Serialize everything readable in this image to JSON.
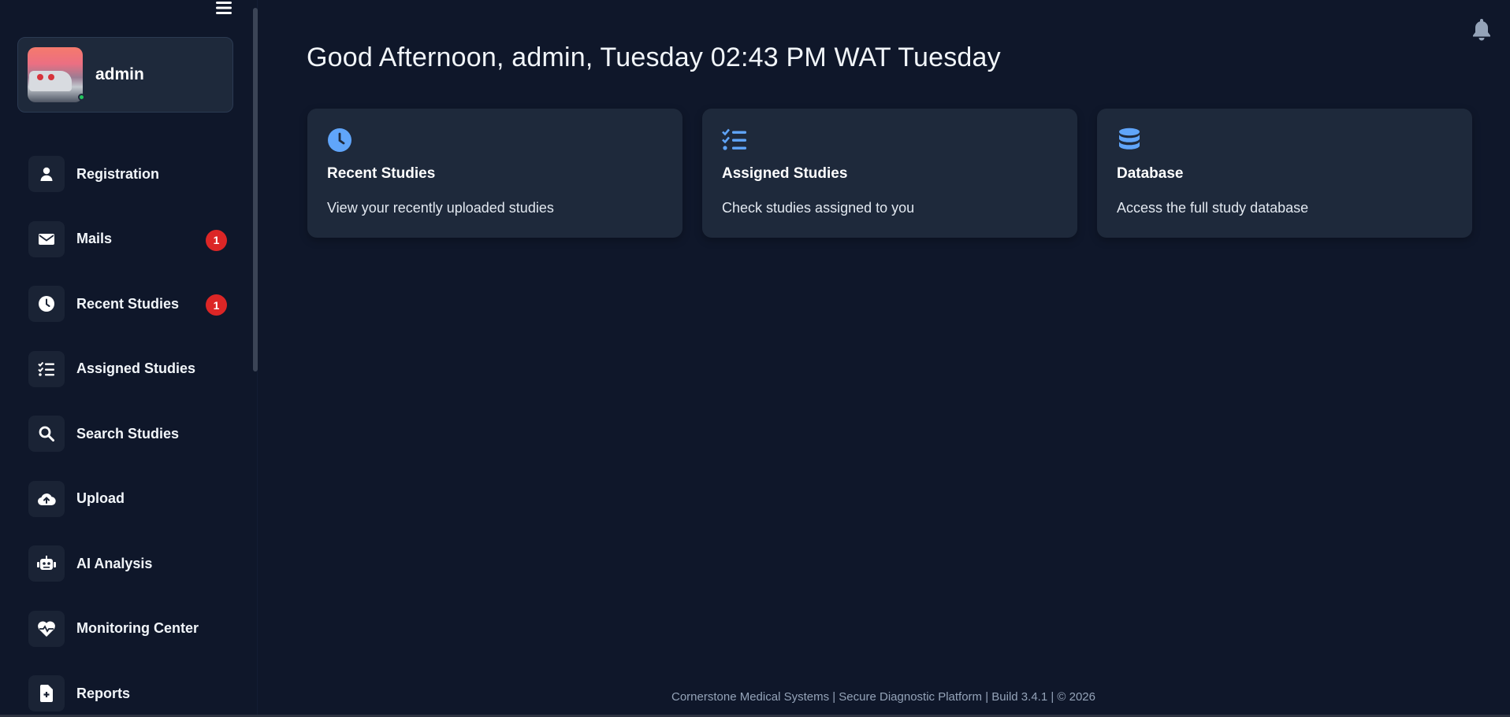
{
  "user": {
    "name": "admin"
  },
  "greeting": "Good Afternoon, admin, Tuesday 02:43 PM WAT Tuesday",
  "sidebar": {
    "items": [
      {
        "label": "Registration",
        "icon": "user-icon"
      },
      {
        "label": "Mails",
        "icon": "envelope-icon",
        "badge": "1"
      },
      {
        "label": "Recent Studies",
        "icon": "clock-icon",
        "badge": "1"
      },
      {
        "label": "Assigned Studies",
        "icon": "checklist-icon"
      },
      {
        "label": "Search Studies",
        "icon": "search-icon"
      },
      {
        "label": "Upload",
        "icon": "cloud-upload-icon"
      },
      {
        "label": "AI Analysis",
        "icon": "robot-icon"
      },
      {
        "label": "Monitoring Center",
        "icon": "heart-pulse-icon"
      },
      {
        "label": "Reports",
        "icon": "file-medical-icon"
      }
    ]
  },
  "cards": [
    {
      "title": "Recent Studies",
      "description": "View your recently uploaded studies",
      "icon": "clock-icon"
    },
    {
      "title": "Assigned Studies",
      "description": "Check studies assigned to you",
      "icon": "checklist-icon"
    },
    {
      "title": "Database",
      "description": "Access the full study database",
      "icon": "database-icon"
    }
  ],
  "footer": "Cornerstone Medical Systems | Secure Diagnostic Platform | Build 3.4.1 | © 2026",
  "colors": {
    "background": "#0f172a",
    "card": "#1e293b",
    "accent": "#60a5fa",
    "badge": "#dc2626",
    "online": "#22c55e"
  }
}
